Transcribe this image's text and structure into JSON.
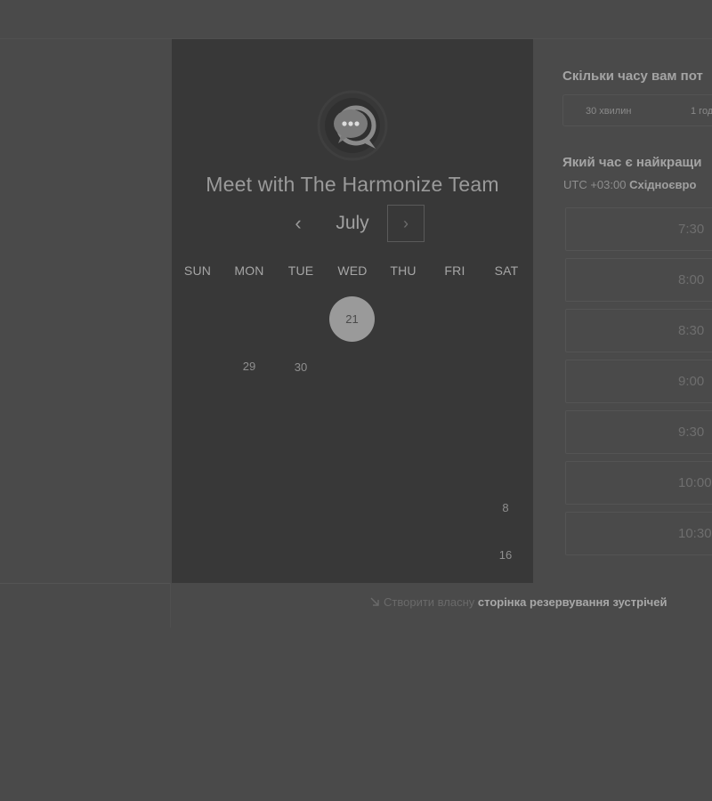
{
  "calendar": {
    "title": "Meet with The Harmonize Team",
    "month": "July",
    "prev_icon": "‹",
    "next_icon": "›",
    "weekdays": [
      "SUN",
      "MON",
      "TUE",
      "WED",
      "THU",
      "FRI",
      "SAT"
    ],
    "selected_day": "21",
    "days": [
      "29",
      "30",
      "8",
      "16"
    ]
  },
  "right": {
    "duration_question": "Скільки часу вам пот",
    "durations": [
      "30 хвилин",
      "1 год"
    ],
    "time_question": "Який час є найкращи",
    "timezone_prefix": "UTC +03:00",
    "timezone_name": "Східноєвро",
    "slots": [
      "7:30",
      "8:00",
      "8:30",
      "9:00",
      "9:30",
      "10:00",
      "10:30"
    ]
  },
  "footer": {
    "prefix": "Створити власну",
    "link": "сторінка резервування зустрічей"
  },
  "colors": {
    "background": "#4a4a4a",
    "card": "#383838",
    "selected_day": "#9a9a9a"
  }
}
